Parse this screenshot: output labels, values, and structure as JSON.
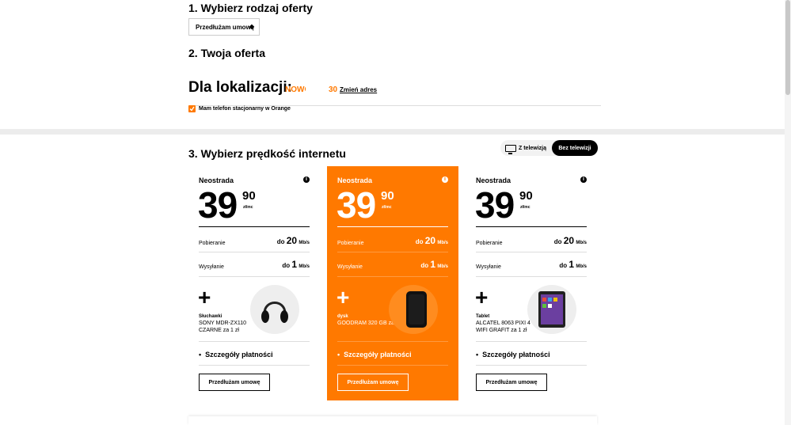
{
  "step1": {
    "title": "1. Wybierz rodzaj oferty",
    "select_value": "Przedłużam umowę"
  },
  "step2": {
    "title": "2. Twoja oferta"
  },
  "location": {
    "title": "Dla lokalizacji:",
    "city": "NOWO",
    "number": "30",
    "change_link": "Zmień adres",
    "phone_checkbox": "Mam telefon stacjonarny w Orange"
  },
  "step3": {
    "title": "3. Wybierz prędkość internetu",
    "toggle_with": "Z telewizją",
    "toggle_without": "Bez telewizji"
  },
  "cards": [
    {
      "brand": "Neostrada",
      "price_int": "39",
      "price_dec": "90",
      "price_unit": "zł/mc",
      "download_label": "Pobieranie",
      "download_prefix": "do",
      "download_value": "20",
      "download_unit": "Mb/s",
      "upload_label": "Wysyłanie",
      "upload_prefix": "do",
      "upload_value": "1",
      "upload_unit": "Mb/s",
      "plus": "+",
      "gift_type": "Słuchawki",
      "gift_name": "SONY MDR-ZX110 CZARNE za 1 zł",
      "details": "Szczegóły płatności",
      "button": "Przedłużam umowę",
      "icon": "headphones-icon"
    },
    {
      "brand": "Neostrada",
      "price_int": "39",
      "price_dec": "90",
      "price_unit": "zł/mc",
      "download_label": "Pobieranie",
      "download_prefix": "do",
      "download_value": "20",
      "download_unit": "Mb/s",
      "upload_label": "Wysyłanie",
      "upload_prefix": "do",
      "upload_value": "1",
      "upload_unit": "Mb/s",
      "plus": "+",
      "gift_type": "dysk",
      "gift_name": "GOODRAM 320 GB za 1 zł",
      "details": "Szczegóły płatności",
      "button": "Przedłużam umowę",
      "icon": "external-drive-icon"
    },
    {
      "brand": "Neostrada",
      "price_int": "39",
      "price_dec": "90",
      "price_unit": "zł/mc",
      "download_label": "Pobieranie",
      "download_prefix": "do",
      "download_value": "20",
      "download_unit": "Mb/s",
      "upload_label": "Wysyłanie",
      "upload_prefix": "do",
      "upload_value": "1",
      "upload_unit": "Mb/s",
      "plus": "+",
      "gift_type": "Tablet",
      "gift_name": "ALCATEL 8063 PIXI 4 7\" WIFI GRAFIT za 1 zł",
      "details": "Szczegóły płatności",
      "button": "Przedłużam umowę",
      "icon": "tablet-icon"
    }
  ],
  "colors": {
    "accent": "#ff7900",
    "background": "#ececec"
  }
}
